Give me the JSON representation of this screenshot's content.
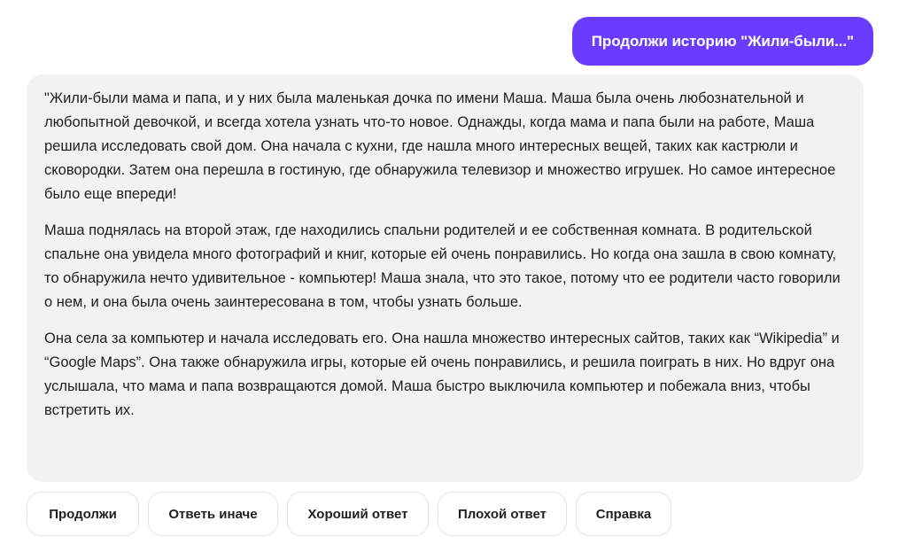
{
  "user_message": {
    "text": "Продолжи историю \"Жили-были...\""
  },
  "bot_message": {
    "paragraphs": [
      "\"Жили-были мама и папа, и у них была маленькая дочка по имени Маша. Маша была очень любознательной и любопытной девочкой, и всегда хотела узнать что-то новое. Однажды, когда мама и папа были на работе, Маша решила исследовать свой дом. Она начала с кухни, где нашла много интересных вещей, таких как кастрюли и сковородки. Затем она перешла в гостиную, где обнаружила телевизор и множество игрушек. Но самое интересное было еще впереди!",
      "Маша поднялась на второй этаж, где находились спальни родителей и ее собственная комната. В родительской спальне она увидела много фотографий и книг, которые ей очень понравились. Но когда она зашла в свою комнату, то обнаружила нечто удивительное - компьютер! Маша знала, что это такое, потому что ее родители часто говорили о нем, и она была очень заинтересована в том, чтобы узнать больше.",
      "Она села за компьютер и начала исследовать его. Она нашла множество интересных сайтов, таких как “Wikipedia” и “Google Maps”. Она также обнаружила игры, которые ей очень понравились, и решила поиграть в них. Но вдруг она услышала, что мама и папа возвращаются домой. Маша быстро выключила компьютер и побежала вниз, чтобы встретить их."
    ]
  },
  "actions": [
    {
      "label": "Продолжи"
    },
    {
      "label": "Ответь иначе"
    },
    {
      "label": "Хороший ответ"
    },
    {
      "label": "Плохой ответ"
    },
    {
      "label": "Справка"
    }
  ],
  "colors": {
    "user_bubble": "#6a3cff",
    "bot_bubble": "#f1f2f4",
    "button_border": "#e3e4e8"
  }
}
